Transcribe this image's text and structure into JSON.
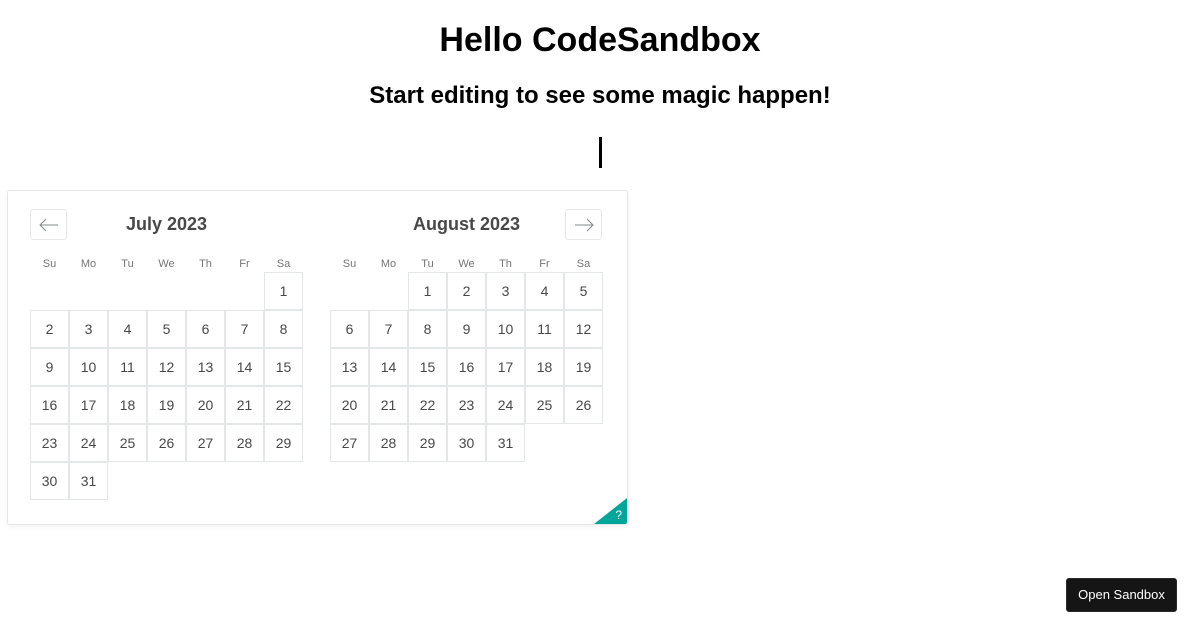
{
  "page": {
    "title": "Hello CodeSandbox",
    "subtitle": "Start editing to see some magic happen!"
  },
  "calendar": {
    "nav": {
      "prev_icon": "arrow-left-icon",
      "next_icon": "arrow-right-icon",
      "help_label": "?"
    },
    "weekdays": [
      "Su",
      "Mo",
      "Tu",
      "We",
      "Th",
      "Fr",
      "Sa"
    ],
    "months": [
      {
        "title": "July 2023",
        "first_weekday": 6,
        "days": 31
      },
      {
        "title": "August 2023",
        "first_weekday": 2,
        "days": 31
      }
    ],
    "accent_color": "#00a699"
  },
  "sandbox_button": {
    "label": "Open Sandbox"
  }
}
